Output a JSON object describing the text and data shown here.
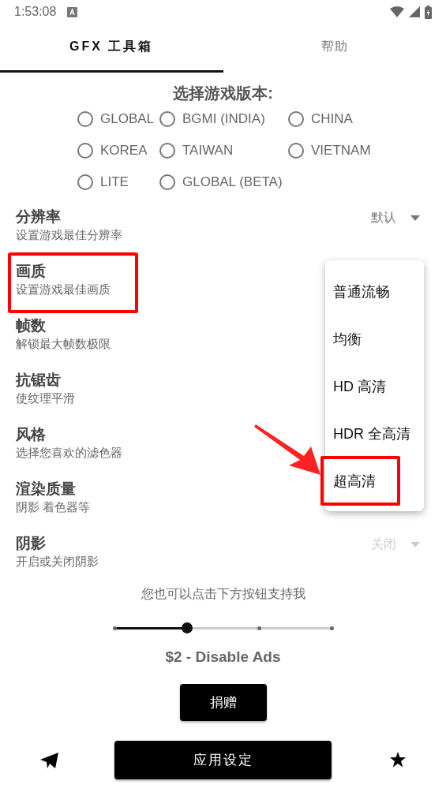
{
  "status_bar": {
    "time": "1:53:08"
  },
  "tabs": [
    {
      "label": "GFX 工具箱",
      "selected": true
    },
    {
      "label": "帮助",
      "selected": false
    }
  ],
  "version_picker": {
    "title": "选择游戏版本:",
    "options": [
      {
        "label": "GLOBAL",
        "selected": false
      },
      {
        "label": "BGMI (INDIA)",
        "selected": false
      },
      {
        "label": "CHINA",
        "selected": false
      },
      {
        "label": "KOREA",
        "selected": false
      },
      {
        "label": "TAIWAN",
        "selected": false
      },
      {
        "label": "VIETNAM",
        "selected": false
      },
      {
        "label": "LITE",
        "selected": false
      },
      {
        "label": "GLOBAL (BETA)",
        "selected": false
      }
    ]
  },
  "settings": [
    {
      "title": "分辨率",
      "subtitle": "设置游戏最佳分辨率",
      "value": "默认",
      "disabled": false,
      "highlighted": false
    },
    {
      "title": "画质",
      "subtitle": "设置游戏最佳画质",
      "highlighted": true
    },
    {
      "title": "帧数",
      "subtitle": "解锁最大帧数极限",
      "highlighted": false
    },
    {
      "title": "抗锯齿",
      "subtitle": "使纹理平滑",
      "highlighted": false
    },
    {
      "title": "风格",
      "subtitle": "选择您喜欢的滤色器",
      "highlighted": false
    },
    {
      "title": "渲染质量",
      "subtitle": "阴影 着色器等",
      "highlighted": false
    },
    {
      "title": "阴影",
      "subtitle": "开启或关闭阴影",
      "value": "关闭",
      "disabled": true,
      "highlighted": false
    }
  ],
  "dropdown_menu": {
    "items": [
      {
        "label": "普通流畅",
        "highlighted": false
      },
      {
        "label": "均衡",
        "highlighted": false
      },
      {
        "label": "HD 高清",
        "highlighted": false
      },
      {
        "label": "HDR 全高清",
        "highlighted": false
      },
      {
        "label": "超高清",
        "highlighted": true
      }
    ]
  },
  "support": {
    "text": "您也可以点击下方按钮支持我",
    "tier_slider": {
      "level": 0.333
    },
    "price_label": "$2 - Disable Ads",
    "donate_button": "捐赠"
  },
  "apply_button": "应用设定"
}
